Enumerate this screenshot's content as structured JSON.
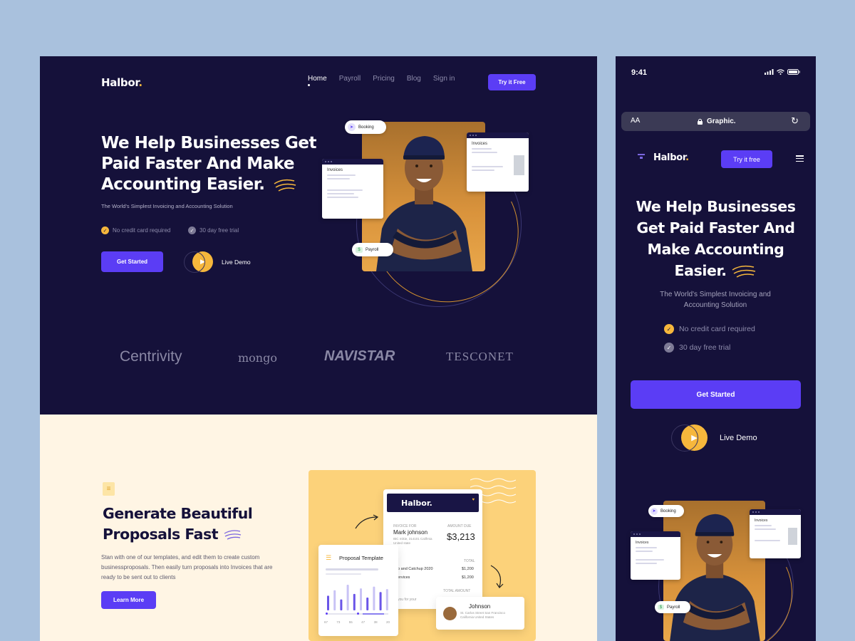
{
  "desktop": {
    "brand": "Halbor",
    "brand_dot": ".",
    "nav": [
      "Home",
      "Payroll",
      "Pricing",
      "Blog",
      "Sign in"
    ],
    "try_button": "Try it Free",
    "headline": "We Help Businesses Get Paid Faster And Make Accounting Easier.",
    "subheadline": "The World's Simplest Invoicing and Accounting Solution",
    "checks": [
      "No credit card required",
      "30 day free trial"
    ],
    "get_started": "Get Started",
    "live_demo": "Live Demo",
    "hero_cards": {
      "booking": "Booking",
      "invoices": "Invoices",
      "payroll": "Payroll"
    },
    "partner_logos": [
      "Centrivity",
      "mongo",
      "NAVISTAR",
      "TESCONET"
    ],
    "proposals": {
      "title": "Generate Beautiful Proposals Fast",
      "body": "Stan with one of our templates, and edit them to create custom businessproposals. Then easily turn proposals into Invoices that are ready to be sent out to clients",
      "button": "Learn More",
      "invoice_card": {
        "brand": "Halbor.",
        "invoice_for_label": "INVOICE FOR",
        "client": "Mark johnson",
        "address": "IBC mikie, 314101 Califrnia United state",
        "amount_label": "AMOUNT DUE",
        "amount": "$3,213",
        "total_label": "TOTAL",
        "line_items": [
          {
            "name": "p and Catchup 2020",
            "amount": "$1,200"
          },
          {
            "name": "ervices",
            "amount": "$1,200"
          }
        ],
        "total_amount_label": "TOTAL AMOUNT",
        "thanks": "you for your"
      },
      "template_card": {
        "title": "Proposal Template",
        "chart_values": [
          40,
          55,
          30,
          70,
          45,
          60,
          35,
          65,
          50,
          58
        ],
        "axis_labels": [
          "67",
          "73",
          "55",
          "47",
          "38",
          "20"
        ]
      },
      "contact_card": {
        "name": "Johnson",
        "address": "St. Carlos Street San Francisco California United States"
      }
    }
  },
  "mobile": {
    "time": "9:41",
    "url_aa": "AA",
    "url": "Graphic.",
    "brand": "Halbor",
    "brand_dot": ".",
    "try_button": "Try it free",
    "headline": "We Help Businesses Get Paid Faster And Make Accounting Easier.",
    "subheadline": "The World's Simplest Invoicing and Accounting Solution",
    "checks": [
      "No credit card required",
      "30 day free trial"
    ],
    "get_started": "Get Started",
    "live_demo": "Live Demo",
    "hero_cards": {
      "booking": "Booking",
      "invoices": "Invoices",
      "payroll": "Payroll"
    }
  },
  "colors": {
    "background": "#a9c1dd",
    "hero_bg": "#15113a",
    "accent_purple": "#5b3df5",
    "accent_yellow": "#f6b73c",
    "cream": "#fff5e4"
  }
}
